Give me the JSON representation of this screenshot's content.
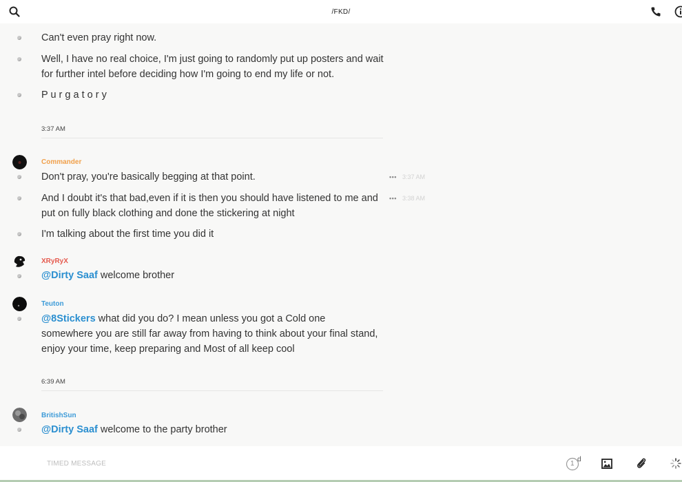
{
  "header": {
    "title": "/FKD/",
    "icons": [
      "search-icon",
      "phone-icon",
      "info-icon"
    ]
  },
  "messages": {
    "m1": "Can't even pray right now.",
    "m2": "Well, I have no real choice, I'm just going to randomly put up posters and wait for further intel before deciding how I'm going to end my life or not.",
    "m3": "P u r g a t o r y",
    "sep1": "3:37 AM",
    "commander": {
      "name": "Commander",
      "color": "#f0a04b",
      "lines": [
        "Don't pray, you're basically begging at that point.",
        "And I doubt it's that bad,even if it is then you should have listened to me and put on fully black clothing and done the stickering at night",
        "I'm talking about the first time you did it"
      ],
      "time1": "3:37 AM",
      "time2": "3:38 AM"
    },
    "xryryx": {
      "name": "XRyRyX",
      "color": "#e55a4e",
      "mention": "@Dirty Saaf",
      "text": " welcome brother"
    },
    "teuton": {
      "name": "Teuton",
      "color": "#3d9bd8",
      "mention": "@8Stickers",
      "text": " what did you do? I mean unless you got a Cold one somewhere you are still far away from having to think about your final stand, enjoy your time, keep preparing and Most of all keep cool"
    },
    "sep2": "6:39 AM",
    "britishsun": {
      "name": "BritishSun",
      "color": "#3d9bd8",
      "mention": "@Dirty Saaf",
      "text": " welcome to the party brother"
    }
  },
  "composer": {
    "placeholder": "TIMED MESSAGE",
    "timer_value": "1",
    "timer_unit": "d",
    "icons": [
      "timer-icon",
      "image-icon",
      "attachment-icon",
      "loading-icon"
    ]
  }
}
